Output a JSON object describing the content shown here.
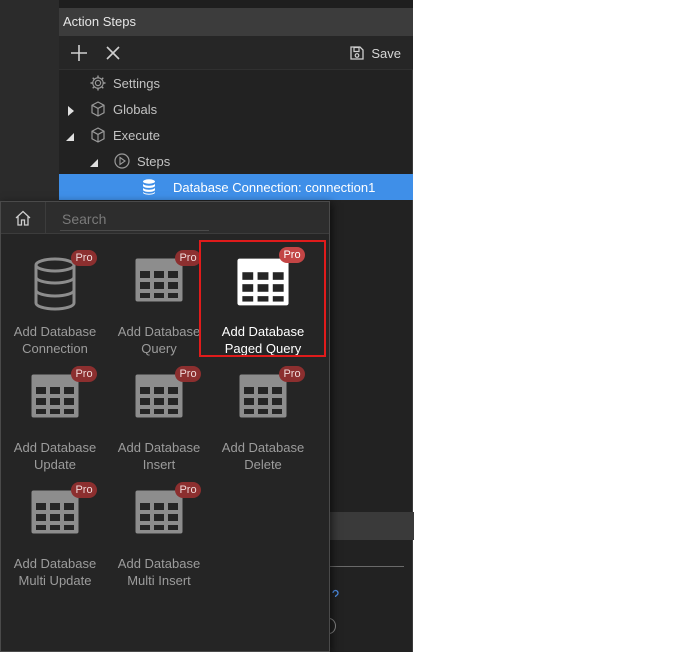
{
  "panel": {
    "title": "Action Steps",
    "toolbar": {
      "add_icon": "plus-icon",
      "close_icon": "close-icon",
      "save_label": "Save",
      "save_icon": "save-icon"
    },
    "tree": [
      {
        "label": "Settings",
        "icon": "gear-icon",
        "expander": "none"
      },
      {
        "label": "Globals",
        "icon": "cube-icon",
        "expander": "collapsed"
      },
      {
        "label": "Execute",
        "icon": "cube-icon",
        "expander": "expanded"
      },
      {
        "label": "Steps",
        "icon": "play-circle-icon",
        "expander": "expanded"
      },
      {
        "label": "Database Connection: connection1",
        "icon": "database-icon",
        "expander": "none",
        "selected": true
      }
    ]
  },
  "popup": {
    "home_icon": "home-icon",
    "search": {
      "placeholder": "Search",
      "value": ""
    },
    "badge_label": "Pro",
    "tiles": [
      {
        "label": "Add Database\nConnection",
        "icon": "database-icon",
        "pro": true
      },
      {
        "label": "Add Database\nQuery",
        "icon": "table-icon",
        "pro": true
      },
      {
        "label": "Add Database\nPaged Query",
        "icon": "table-icon",
        "pro": true,
        "highlighted": true
      },
      {
        "label": "Add Database\nUpdate",
        "icon": "table-icon",
        "pro": true
      },
      {
        "label": "Add Database\nInsert",
        "icon": "table-icon",
        "pro": true
      },
      {
        "label": "Add Database\nDelete",
        "icon": "table-icon",
        "pro": true
      },
      {
        "label": "Add Database\nMulti Update",
        "icon": "table-icon",
        "pro": true
      },
      {
        "label": "Add Database\nMulti Insert",
        "icon": "table-icon",
        "pro": true
      }
    ]
  },
  "colors": {
    "selection": "#3f8fe8",
    "pro_badge": "#8c2f2f",
    "highlight_border": "#e01b1b"
  }
}
